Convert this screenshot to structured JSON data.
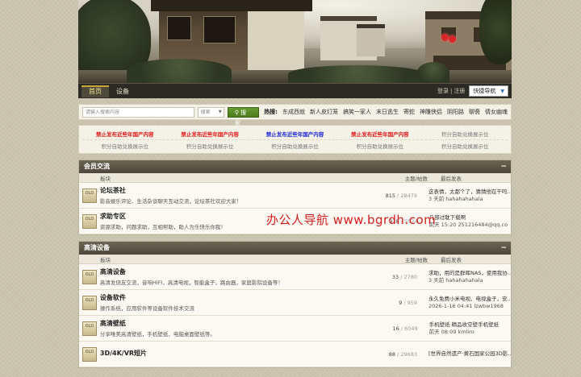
{
  "nav": {
    "tabs": [
      {
        "label": "首页",
        "active": true
      },
      {
        "label": "设备",
        "active": false
      }
    ],
    "login": "登录",
    "divider": "|",
    "register": "注册",
    "quick_nav": "快捷导航"
  },
  "search": {
    "placeholder": "请输入搜索内容",
    "type": "搜索",
    "button": "搜 索",
    "hot_label": "热搜:",
    "hot": [
      "东成西就",
      "新人皮灯笼",
      "搞笑一家人",
      "末日逃生",
      "寄蛇",
      "神雕侠侣",
      "阴阳路",
      "聊斋",
      "倩女幽魂"
    ]
  },
  "ads": {
    "row1": [
      {
        "text": "禁止发布近些年国产内容",
        "color": "#e01a1a"
      },
      {
        "text": "禁止发布近些年国产内容",
        "color": "#e01a1a"
      },
      {
        "text": "禁止发布近些年国产内容",
        "color": "#1f2ad6"
      },
      {
        "text": "禁止发布近些年国产内容",
        "color": "#e01a1a"
      },
      {
        "text": "积分自助兑换展示位",
        "color": "#777777"
      }
    ],
    "row2": [
      "积分自助兑换展示位",
      "积分自助兑换展示位",
      "积分自助兑换展示位",
      "积分自助兑换展示位",
      "积分自助兑换展示位"
    ]
  },
  "columns": {
    "board": "板块",
    "count": "主题/帖数",
    "last": "最后发表"
  },
  "sections": [
    {
      "title": "会员交流",
      "collapse": "−",
      "forums": [
        {
          "icon": "OLD",
          "name": "论坛茶社",
          "desc": "影音娱乐评论、生活杂谈聊天互动交流，论坛茶社欢迎大家！",
          "topics": "815",
          "posts": "28479",
          "last_title": "这表情，太都个了，猜猜他在干吗...",
          "last_meta": "3 天前 hahahahahala"
        },
        {
          "icon": "OLD",
          "name": "求助专区",
          "desc": "资源求助，问题求助，互相帮助，助人为乐快乐你我！",
          "topics": "918",
          "posts": "5574",
          "last_title": "几部过耽下载啊",
          "last_meta": "前天 15:20 251216484@qq.co"
        }
      ]
    },
    {
      "title": "高清设备",
      "collapse": "−",
      "forums": [
        {
          "icon": "OLD",
          "name": "高清设备",
          "desc": "高清发烧友交流，音响HIFI，高清电视，智能盒子，路由器，家庭影院设备等！",
          "topics": "33",
          "posts": "2780",
          "last_title": "求助，用的是群晖NAS，使用我协...",
          "last_meta": "3 天前 hahahahahala"
        },
        {
          "icon": "OLD",
          "name": "设备软件",
          "desc": "操作系统，应用软件等设备软件技术交流",
          "topics": "9",
          "posts": "959",
          "last_title": "永久免费小米电视、电视盒子，安...",
          "last_meta": "2026-1-16 04:41 lzwbw1968"
        },
        {
          "icon": "OLD",
          "name": "高清壁纸",
          "desc": "分享唯美高清壁纸，手机壁纸、电脑桌面壁纸等。",
          "topics": "16",
          "posts": "6049",
          "last_title": "手机壁纸 精品收空壁手机壁纸",
          "last_meta": "前天 08:09 kmliro"
        },
        {
          "icon": "OLD",
          "name": "3D/4K/VR短片",
          "desc": "",
          "topics": "88",
          "posts": "29683",
          "last_title": "[世界自然遗产·黄石国家公园3D影...",
          "last_meta": ""
        }
      ]
    }
  ],
  "watermark": "办公人导航  www.bgrdh.com"
}
